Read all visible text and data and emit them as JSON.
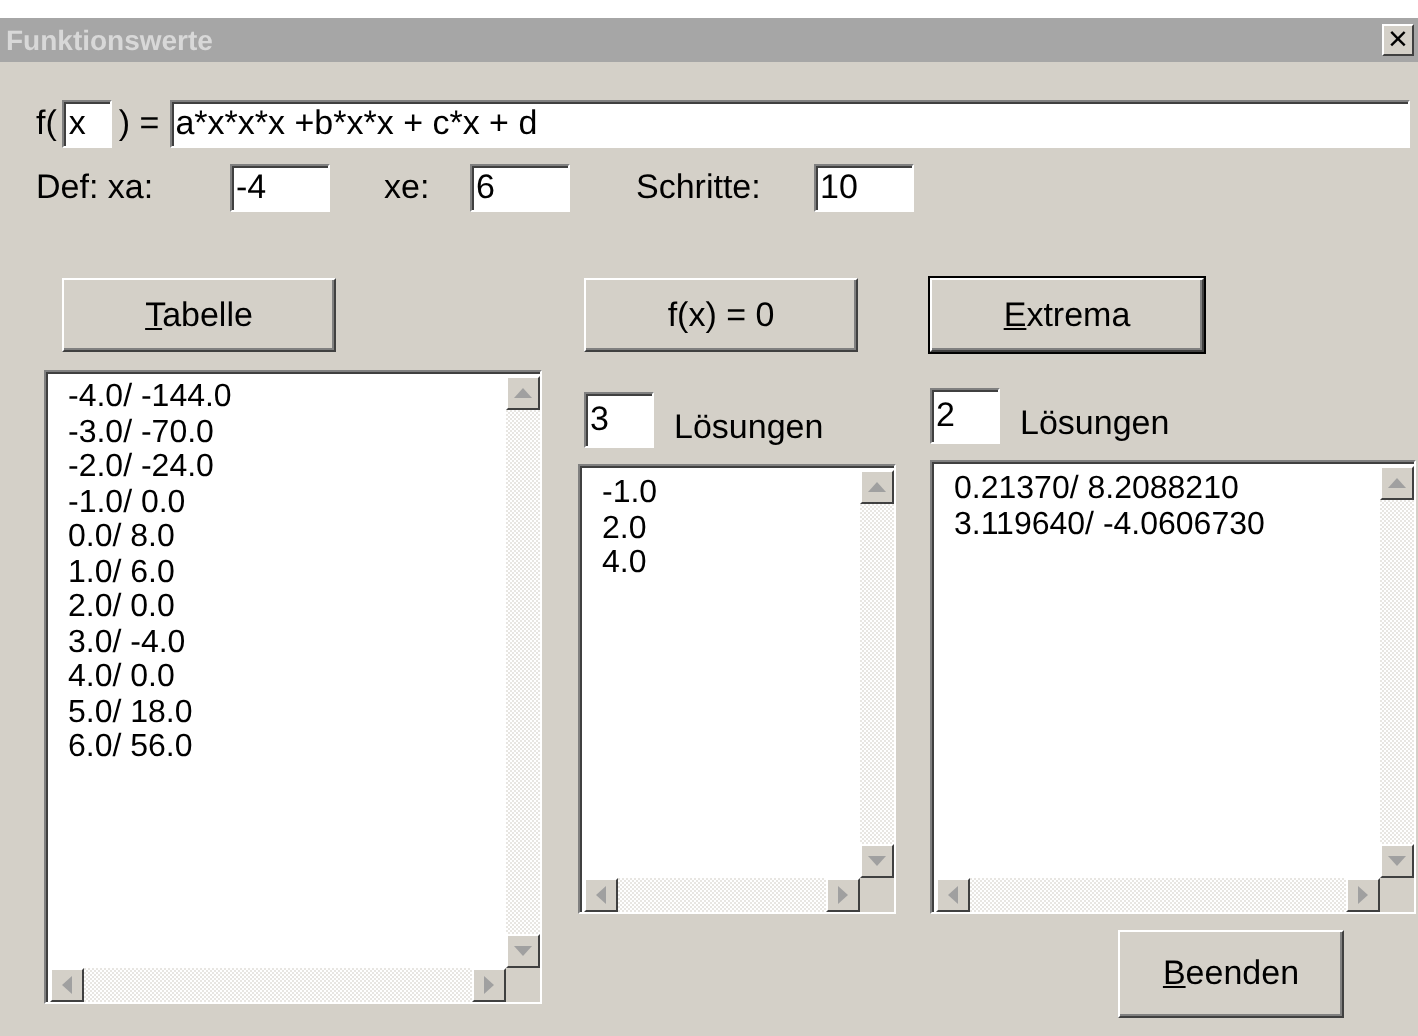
{
  "window": {
    "title": "Funktionswerte",
    "close": "×"
  },
  "function_row": {
    "prefix": "f(",
    "variable": "x",
    "equals": ") =",
    "formula": "a*x*x*x +b*x*x + c*x + d"
  },
  "definition_row": [
    {
      "label": "Def: xa:",
      "value": "-4"
    },
    {
      "label": "xe:",
      "value": "6"
    },
    {
      "label": "Schritte:",
      "value": "10"
    }
  ],
  "panels": [
    {
      "button": {
        "key": "T",
        "rest": "abelle",
        "default": false
      },
      "items": [
        "-4.0/ -144.0",
        "-3.0/ -70.0",
        "-2.0/ -24.0",
        "-1.0/ 0.0",
        "0.0/ 8.0",
        "1.0/ 6.0",
        "2.0/ 0.0",
        "3.0/ -4.0",
        "4.0/ 0.0",
        "5.0/ 18.0",
        "6.0/ 56.0"
      ]
    },
    {
      "button": {
        "rest": "f(x) = 0",
        "default": false
      },
      "count": "3",
      "count_label": "Lösungen",
      "items": [
        "-1.0",
        "2.0",
        "4.0"
      ]
    },
    {
      "button": {
        "key": "E",
        "rest": "xtrema",
        "default": true
      },
      "count": "2",
      "count_label": "Lösungen",
      "items": [
        "0.21370/ 8.2088210",
        "3.119640/ -4.0606730"
      ]
    }
  ],
  "footer_button": {
    "key": "B",
    "rest": "eenden"
  }
}
